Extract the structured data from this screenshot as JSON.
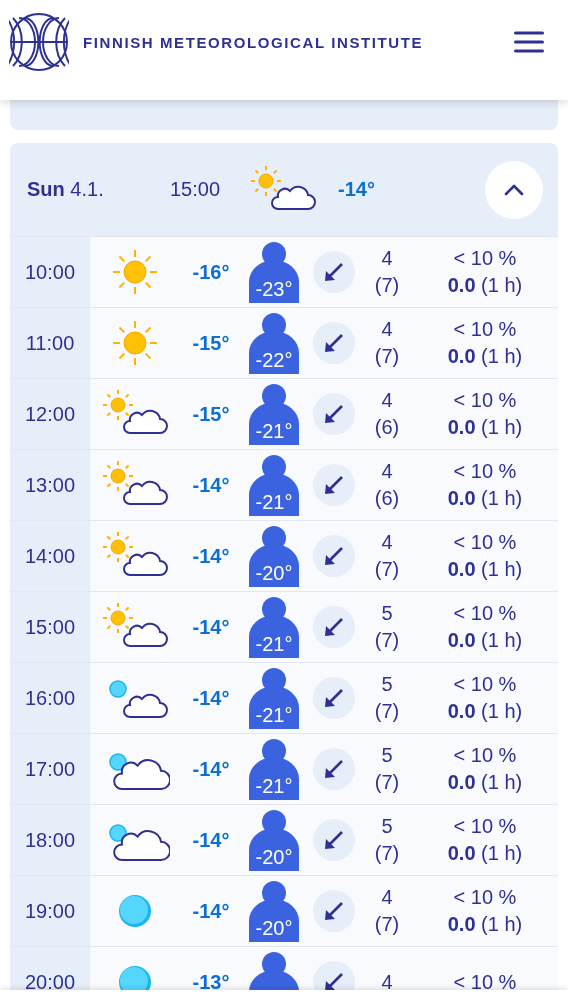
{
  "header": {
    "title": "FINNISH METEOROLOGICAL INSTITUTE"
  },
  "day": {
    "weekday": "Sun",
    "date": "4.1.",
    "time": "15:00",
    "kind": "partly_cloudy",
    "temperature": "-14°",
    "expanded": true
  },
  "rows": [
    {
      "time": "10:00",
      "kind": "sun",
      "temperature": "-16°",
      "feels_like": "-23°",
      "wind_speed": "4",
      "wind_gust": "(7)",
      "rain_probability": "< 10 %",
      "rain": "**0.0** (1 h)"
    },
    {
      "time": "11:00",
      "kind": "sun",
      "temperature": "-15°",
      "feels_like": "-22°",
      "wind_speed": "4",
      "wind_gust": "(7)",
      "rain_probability": "< 10 %",
      "rain": "**0.0** (1 h)"
    },
    {
      "time": "12:00",
      "kind": "partly_cloudy",
      "temperature": "-15°",
      "feels_like": "-21°",
      "wind_speed": "4",
      "wind_gust": "(6)",
      "rain_probability": "< 10 %",
      "rain": "**0.0** (1 h)"
    },
    {
      "time": "13:00",
      "kind": "partly_cloudy",
      "temperature": "-14°",
      "feels_like": "-21°",
      "wind_speed": "4",
      "wind_gust": "(6)",
      "rain_probability": "< 10 %",
      "rain": "**0.0** (1 h)"
    },
    {
      "time": "14:00",
      "kind": "partly_cloudy",
      "temperature": "-14°",
      "feels_like": "-20°",
      "wind_speed": "4",
      "wind_gust": "(7)",
      "rain_probability": "< 10 %",
      "rain": "**0.0** (1 h)"
    },
    {
      "time": "15:00",
      "kind": "partly_cloudy",
      "temperature": "-14°",
      "feels_like": "-21°",
      "wind_speed": "5",
      "wind_gust": "(7)",
      "rain_probability": "< 10 %",
      "rain": "**0.0** (1 h)"
    },
    {
      "time": "16:00",
      "kind": "night_partly_cloudy",
      "temperature": "-14°",
      "feels_like": "-21°",
      "wind_speed": "5",
      "wind_gust": "(7)",
      "rain_probability": "< 10 %",
      "rain": "**0.0** (1 h)"
    },
    {
      "time": "17:00",
      "kind": "night_cloudy",
      "temperature": "-14°",
      "feels_like": "-21°",
      "wind_speed": "5",
      "wind_gust": "(7)",
      "rain_probability": "< 10 %",
      "rain": "**0.0** (1 h)"
    },
    {
      "time": "18:00",
      "kind": "night_cloudy",
      "temperature": "-14°",
      "feels_like": "-20°",
      "wind_speed": "5",
      "wind_gust": "(7)",
      "rain_probability": "< 10 %",
      "rain": "**0.0** (1 h)"
    },
    {
      "time": "19:00",
      "kind": "night_clear",
      "temperature": "-14°",
      "feels_like": "-20°",
      "wind_speed": "4",
      "wind_gust": "(7)",
      "rain_probability": "< 10 %",
      "rain": "**0.0** (1 h)"
    },
    {
      "time": "20:00",
      "kind": "night_clear",
      "temperature": "-13°",
      "wind_speed": "4",
      "rain_probability": "< 10 %"
    }
  ]
}
